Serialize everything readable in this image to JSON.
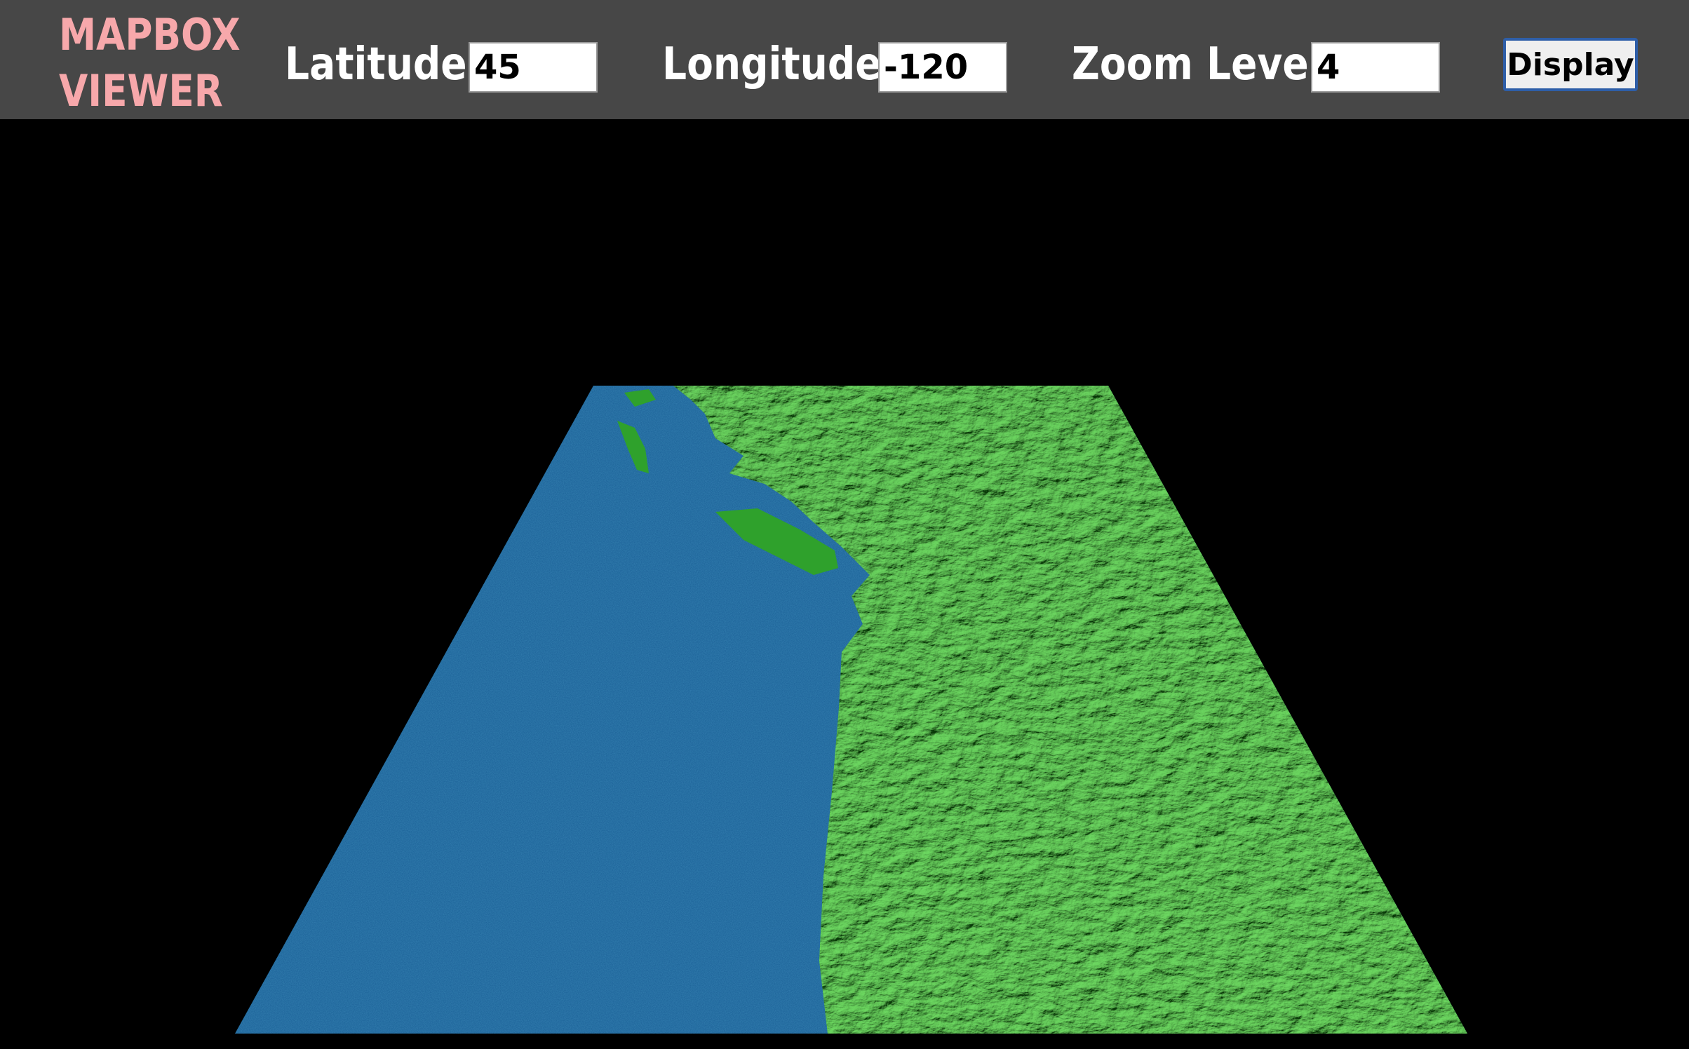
{
  "header": {
    "logo_line1": "MAPBOX",
    "logo_line2": "VIEWER",
    "latitude_label": "Latitude:",
    "latitude_value": "45",
    "longitude_label": "Longitude:",
    "longitude_value": "-120",
    "zoom_label": "Zoom Level:",
    "zoom_value": "4",
    "display_label": "Display"
  },
  "colors": {
    "header_bg": "#474747",
    "logo": "#f7a8ab",
    "ocean": "#1a5f96",
    "land": "#3fb83a",
    "button_border": "#2e5ea8"
  }
}
